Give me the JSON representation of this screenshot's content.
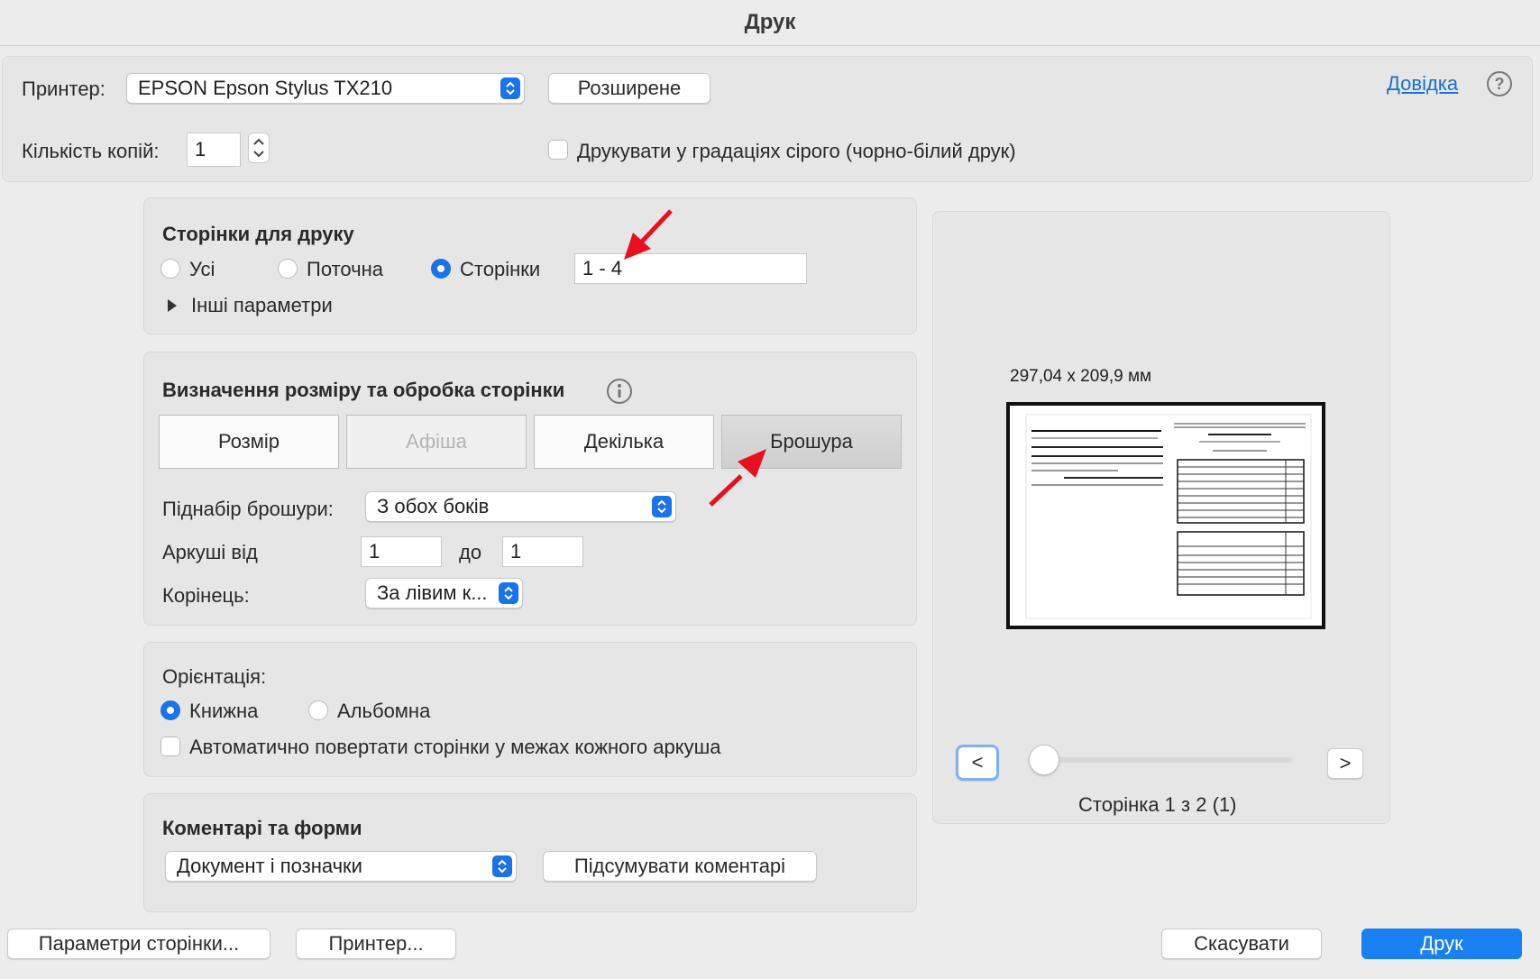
{
  "window": {
    "title": "Друк"
  },
  "printer": {
    "label": "Принтер:",
    "selected": "EPSON Epson Stylus TX210",
    "advanced_label": "Розширене",
    "help_label": "Довідка",
    "copies_label": "Кількість копій:",
    "copies_value": "1",
    "grayscale_label": "Друкувати у градаціях сірого (чорно-білий друк)"
  },
  "pages": {
    "title": "Сторінки для друку",
    "options": [
      {
        "label": "Усі",
        "selected": false
      },
      {
        "label": "Поточна",
        "selected": false
      },
      {
        "label": "Сторінки",
        "selected": true
      }
    ],
    "range_value": "1 - 4",
    "more_label": "Інші параметри"
  },
  "sizing": {
    "title": "Визначення розміру та обробка сторінки",
    "tabs": [
      {
        "label": "Розмір",
        "state": "normal"
      },
      {
        "label": "Афіша",
        "state": "disabled"
      },
      {
        "label": "Декілька",
        "state": "normal"
      },
      {
        "label": "Брошура",
        "state": "active"
      }
    ],
    "subset_label": "Піднабір брошури:",
    "subset_value": "З обох боків",
    "sheets_label": "Аркуші від",
    "sheets_from": "1",
    "sheets_to_label": "до",
    "sheets_to": "1",
    "binding_label": "Корінець:",
    "binding_value": "За лівим к..."
  },
  "orientation": {
    "label": "Орієнтація:",
    "portrait_label": "Книжна",
    "landscape_label": "Альбомна",
    "auto_rotate_label": "Автоматично повертати сторінки у межах кожного аркуша"
  },
  "comments": {
    "title": "Коментарі та форми",
    "select_value": "Документ і позначки",
    "summarize_label": "Підсумувати коментарі"
  },
  "preview": {
    "dimensions": "297,04 x 209,9 мм",
    "prev_label": "<",
    "next_label": ">",
    "page_status": "Сторінка 1 з 2 (1)"
  },
  "footer": {
    "page_setup_label": "Параметри сторінки...",
    "printer_label": "Принтер...",
    "cancel_label": "Скасувати",
    "print_label": "Друк"
  },
  "colors": {
    "accent": "#1a73e8",
    "annotation_arrow": "#e8101e"
  }
}
